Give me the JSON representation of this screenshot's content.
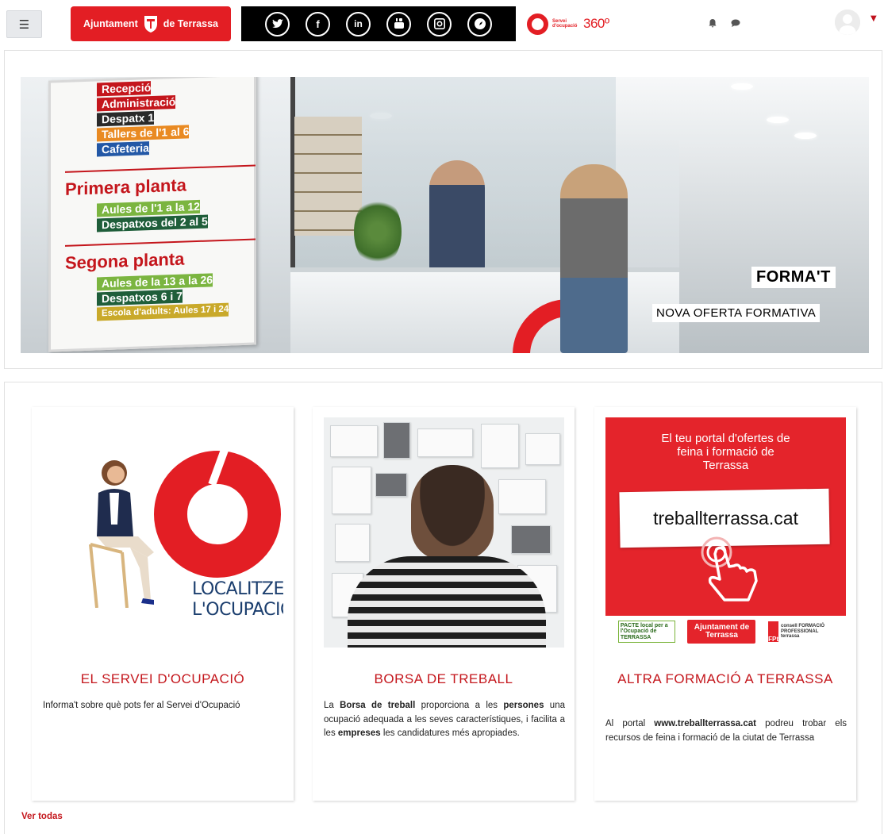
{
  "navbar": {
    "menu_icon": "hamburger-icon",
    "brand_label_left": "Ajuntament",
    "brand_label_right": "de Terrassa",
    "brand_color": "#e31e24",
    "social_icons": [
      "twitter-icon",
      "facebook-icon",
      "linkedin-icon",
      "youtube-icon",
      "instagram-icon",
      "web-icon"
    ],
    "service_logo_small": "Servei d'ocupació",
    "service_logo_big": "360º",
    "notification_icon": "bell-icon",
    "messages_icon": "chat-icon",
    "user_menu_icon": "caret-down-icon"
  },
  "banner": {
    "headline": "FORMA'T",
    "subheadline": "NOVA OFERTA FORMATIVA",
    "sign": {
      "rows_top": [
        "Recepció",
        "Administració",
        "Despatx 1",
        "Tallers de l'1 al 6",
        "Cafeteria"
      ],
      "first_floor": "Primera planta",
      "first_rows": [
        "Aules de l'1 a la 12",
        "Despatxos del 2 al 5"
      ],
      "second_floor": "Segona planta",
      "second_rows": [
        "Aules de la 13 a la 26",
        "Despatxos 6 i 7",
        "Escola d'adults: Aules 17 i 24"
      ]
    }
  },
  "cards": [
    {
      "image_text_line1": "LOCALITZEM",
      "image_text_line2": "L'OCUPACIÓ",
      "title": "EL SERVEI D'OCUPACIÓ",
      "text": "Informa't sobre què pots fer al Servei d'Ocupació"
    },
    {
      "title": "BORSA DE TREBALL",
      "text_parts": [
        "La ",
        "Borsa de treball",
        " proporciona a les ",
        "persones",
        " una ocupació adequada a les seves característiques, i facilita a les ",
        "empreses",
        " les candidatures més apropiades."
      ]
    },
    {
      "image_title": "El teu portal d'ofertes de feina i formació de Terrassa",
      "image_url_text": "treballterrassa.cat",
      "logo_pacte": "PACTE local per a l'Ocupació de TERRASSA",
      "logo_terrassa": "Ajuntament de Terrassa",
      "logo_fpt_mark": "FPt",
      "logo_fpt_text": "consell FORMACIÓ PROFESSIONAL terrassa",
      "title": "ALTRA FORMACIÓ A TERRASSA",
      "text_parts": [
        "Al portal ",
        "www.treballterrassa.cat",
        " podreu trobar els recursos de feina i formació de la ciutat de Terrassa"
      ]
    }
  ],
  "footer": {
    "see_all": "Ver todas"
  }
}
